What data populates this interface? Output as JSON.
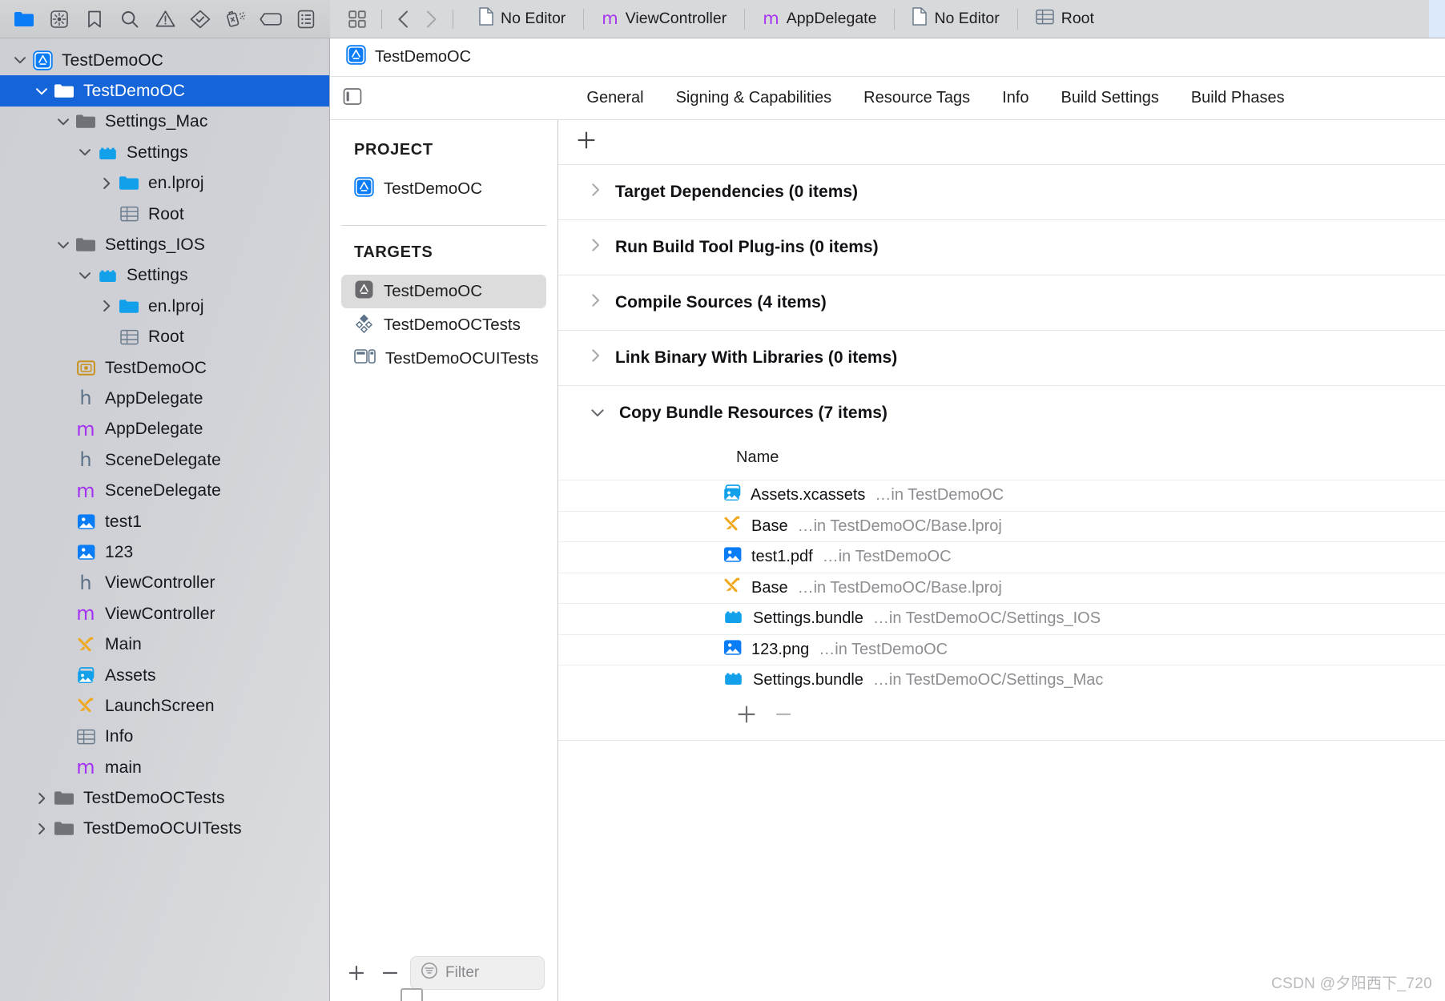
{
  "navigator_toolbar": {
    "icons": [
      {
        "name": "folder-icon",
        "label": "Project navigator"
      },
      {
        "name": "source-control-icon",
        "label": "Source control navigator"
      },
      {
        "name": "bookmark-icon",
        "label": "Bookmark navigator"
      },
      {
        "name": "search-icon",
        "label": "Find navigator"
      },
      {
        "name": "warning-triangle-icon",
        "label": "Issue navigator"
      },
      {
        "name": "test-diamond-icon",
        "label": "Test navigator"
      },
      {
        "name": "debug-spray-icon",
        "label": "Debug navigator"
      },
      {
        "name": "tag-icon",
        "label": "Breakpoint navigator"
      },
      {
        "name": "report-list-icon",
        "label": "Report navigator"
      }
    ]
  },
  "editor_tabs": {
    "grid_icon": "tab-grid-icon",
    "back_icon": "chevron-left-icon",
    "forward_icon": "chevron-right-icon",
    "items": [
      {
        "label": "No Editor",
        "icon": "document-icon"
      },
      {
        "label": "ViewController",
        "icon": "m-file-icon"
      },
      {
        "label": "AppDelegate",
        "icon": "m-file-icon"
      },
      {
        "label": "No Editor",
        "icon": "document-icon"
      },
      {
        "label": "Root",
        "icon": "plist-table-icon"
      }
    ]
  },
  "navigator": {
    "rows": [
      {
        "label": "TestDemoOC",
        "icon": "xcodeproj-icon",
        "indent": 0,
        "twisty": "down",
        "selected": false
      },
      {
        "label": "TestDemoOC",
        "icon": "folder-white-icon",
        "indent": 1,
        "twisty": "down",
        "selected": true
      },
      {
        "label": "Settings_Mac",
        "icon": "folder-gray-icon",
        "indent": 2,
        "twisty": "down",
        "selected": false
      },
      {
        "label": "Settings",
        "icon": "bundle-icon",
        "indent": 3,
        "twisty": "down",
        "selected": false
      },
      {
        "label": "en.lproj",
        "icon": "folder-blue-icon",
        "indent": 4,
        "twisty": "right",
        "selected": false
      },
      {
        "label": "Root",
        "icon": "plist-table-icon",
        "indent": 4,
        "twisty": "none",
        "selected": false
      },
      {
        "label": "Settings_IOS",
        "icon": "folder-gray-icon",
        "indent": 2,
        "twisty": "down",
        "selected": false
      },
      {
        "label": "Settings",
        "icon": "bundle-icon",
        "indent": 3,
        "twisty": "down",
        "selected": false
      },
      {
        "label": "en.lproj",
        "icon": "folder-blue-icon",
        "indent": 4,
        "twisty": "right",
        "selected": false
      },
      {
        "label": "Root",
        "icon": "plist-table-icon",
        "indent": 4,
        "twisty": "none",
        "selected": false
      },
      {
        "label": "TestDemoOC",
        "icon": "entitlements-icon",
        "indent": 2,
        "twisty": "none",
        "selected": false
      },
      {
        "label": "AppDelegate",
        "icon": "h-file-icon",
        "indent": 2,
        "twisty": "none",
        "selected": false
      },
      {
        "label": "AppDelegate",
        "icon": "m-file-icon",
        "indent": 2,
        "twisty": "none",
        "selected": false
      },
      {
        "label": "SceneDelegate",
        "icon": "h-file-icon",
        "indent": 2,
        "twisty": "none",
        "selected": false
      },
      {
        "label": "SceneDelegate",
        "icon": "m-file-icon",
        "indent": 2,
        "twisty": "none",
        "selected": false
      },
      {
        "label": "test1",
        "icon": "image-file-icon",
        "indent": 2,
        "twisty": "none",
        "selected": false
      },
      {
        "label": "123",
        "icon": "image-file-icon",
        "indent": 2,
        "twisty": "none",
        "selected": false
      },
      {
        "label": "ViewController",
        "icon": "h-file-icon",
        "indent": 2,
        "twisty": "none",
        "selected": false
      },
      {
        "label": "ViewController",
        "icon": "m-file-icon",
        "indent": 2,
        "twisty": "none",
        "selected": false
      },
      {
        "label": "Main",
        "icon": "storyboard-icon",
        "indent": 2,
        "twisty": "none",
        "selected": false
      },
      {
        "label": "Assets",
        "icon": "xcassets-icon",
        "indent": 2,
        "twisty": "none",
        "selected": false
      },
      {
        "label": "LaunchScreen",
        "icon": "storyboard-icon",
        "indent": 2,
        "twisty": "none",
        "selected": false
      },
      {
        "label": "Info",
        "icon": "plist-table-icon",
        "indent": 2,
        "twisty": "none",
        "selected": false
      },
      {
        "label": "main",
        "icon": "m-file-icon",
        "indent": 2,
        "twisty": "none",
        "selected": false
      },
      {
        "label": "TestDemoOCTests",
        "icon": "folder-gray-icon",
        "indent": 1,
        "twisty": "right",
        "selected": false
      },
      {
        "label": "TestDemoOCUITests",
        "icon": "folder-gray-icon",
        "indent": 1,
        "twisty": "right",
        "selected": false
      }
    ]
  },
  "jump_bar": {
    "project_name": "TestDemoOC",
    "icon": "xcodeproj-icon"
  },
  "inspector_tabs": {
    "side_toggle_icon": "sidebar-toggle-icon",
    "items": [
      "General",
      "Signing & Capabilities",
      "Resource Tags",
      "Info",
      "Build Settings",
      "Build Phases"
    ]
  },
  "target_pane": {
    "project_heading": "PROJECT",
    "projects": [
      {
        "label": "TestDemoOC",
        "icon": "xcodeproj-icon"
      }
    ],
    "targets_heading": "TARGETS",
    "targets": [
      {
        "label": "TestDemoOC",
        "icon": "app-target-icon",
        "selected": true
      },
      {
        "label": "TestDemoOCTests",
        "icon": "unit-test-icon",
        "selected": false
      },
      {
        "label": "TestDemoOCUITests",
        "icon": "ui-test-icon",
        "selected": false
      }
    ],
    "add_button": "+",
    "remove_button": "−",
    "filter_placeholder": "Filter",
    "filter_value": "",
    "filter_icon": "filter-icon"
  },
  "build_phases": {
    "add_button": "+",
    "phases": [
      {
        "title": "Target Dependencies (0 items)",
        "expanded": false
      },
      {
        "title": "Run Build Tool Plug-ins (0 items)",
        "expanded": false
      },
      {
        "title": "Compile Sources (4 items)",
        "expanded": false
      },
      {
        "title": "Link Binary With Libraries (0 items)",
        "expanded": false
      },
      {
        "title": "Copy Bundle Resources (7 items)",
        "expanded": true
      }
    ],
    "resources": {
      "column_header": "Name",
      "rows": [
        {
          "name": "Assets.xcassets",
          "location": "…in TestDemoOC",
          "icon": "xcassets-icon"
        },
        {
          "name": "Base",
          "location": "…in TestDemoOC/Base.lproj",
          "icon": "storyboard-icon"
        },
        {
          "name": "test1.pdf",
          "location": "…in TestDemoOC",
          "icon": "image-file-icon"
        },
        {
          "name": "Base",
          "location": "…in TestDemoOC/Base.lproj",
          "icon": "storyboard-icon"
        },
        {
          "name": "Settings.bundle",
          "location": "…in TestDemoOC/Settings_IOS",
          "icon": "bundle-icon"
        },
        {
          "name": "123.png",
          "location": "…in TestDemoOC",
          "icon": "image-file-icon"
        },
        {
          "name": "Settings.bundle",
          "location": "…in TestDemoOC/Settings_Mac",
          "icon": "bundle-icon"
        }
      ],
      "add_button": "+",
      "remove_button": "−"
    }
  },
  "watermark": "CSDN @夕阳西下_720",
  "colors": {
    "selection_blue": "#1565d8",
    "accent_blue": "#1a9bf0",
    "m_purple": "#a534f0",
    "storyboard_orange": "#f0a81e",
    "entitlement_gold": "#c9921d",
    "h_slate": "#607183"
  }
}
